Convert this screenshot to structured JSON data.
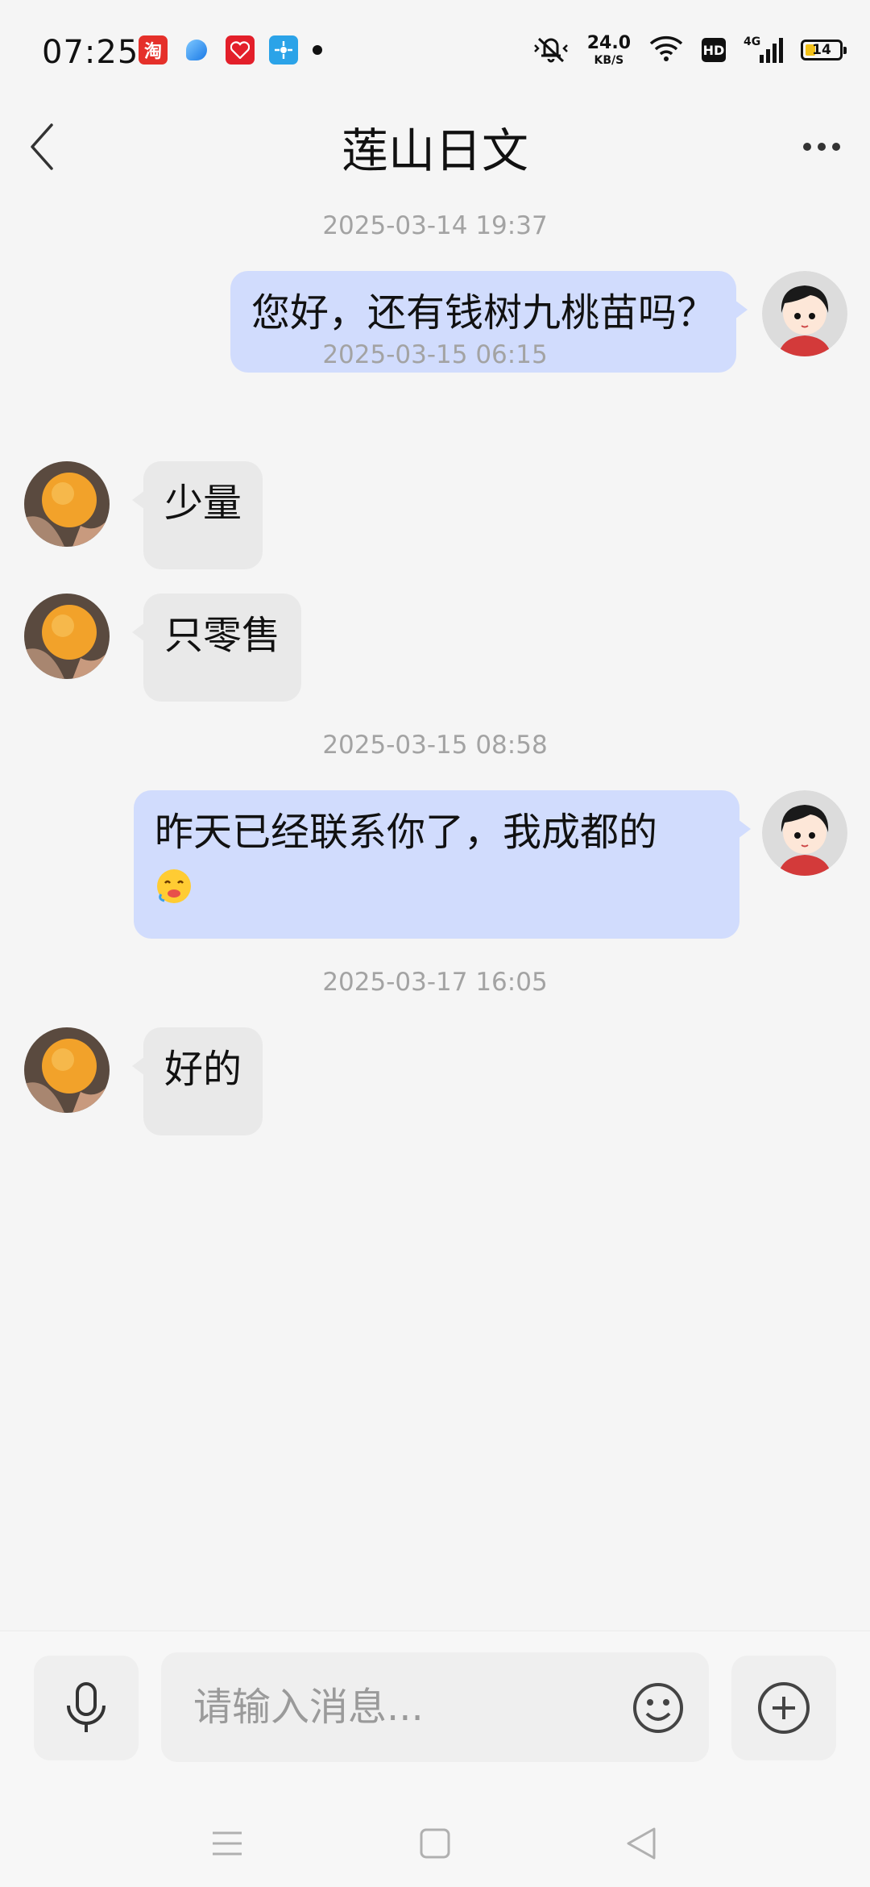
{
  "status_bar": {
    "time": "07:25",
    "app_icons": [
      "taobao-icon",
      "blue-leaf-icon",
      "red-heart-app-icon",
      "tplink-icon"
    ],
    "net_speed_value": "24.0",
    "net_speed_unit": "KB/S",
    "hd_label": "HD",
    "network_label": "4G",
    "battery_level": "14"
  },
  "header": {
    "title": "莲山日文",
    "back_icon": "chevron-left-icon",
    "more_icon": "more-horizontal-icon"
  },
  "messages": [
    {
      "type": "timestamp",
      "text": "2025-03-14 19:37"
    },
    {
      "type": "message",
      "side": "sent",
      "text": "您好，还有钱树九桃苗吗？"
    },
    {
      "type": "timestamp",
      "text": "2025-03-15 06:15"
    },
    {
      "type": "message",
      "side": "received",
      "text": "少量"
    },
    {
      "type": "message",
      "side": "received",
      "text": "只零售"
    },
    {
      "type": "timestamp",
      "text": "2025-03-15 08:58"
    },
    {
      "type": "message",
      "side": "sent",
      "text": "昨天已经联系你了，我成都的",
      "emoji": "yummy-face-emoji"
    },
    {
      "type": "timestamp",
      "text": "2025-03-17 16:05"
    },
    {
      "type": "message",
      "side": "received",
      "text": "好的"
    }
  ],
  "input_bar": {
    "placeholder": "请输入消息...",
    "voice_icon": "microphone-icon",
    "emoji_icon": "smiley-icon",
    "plus_icon": "plus-circle-icon"
  },
  "nav_bar": {
    "icons": [
      "menu-icon",
      "home-square-icon",
      "back-triangle-icon"
    ]
  },
  "colors": {
    "background": "#f5f5f5",
    "sent_bubble": "#d1dcfd",
    "received_bubble": "#e9e9e9",
    "timestamp": "#a3a3a3"
  }
}
